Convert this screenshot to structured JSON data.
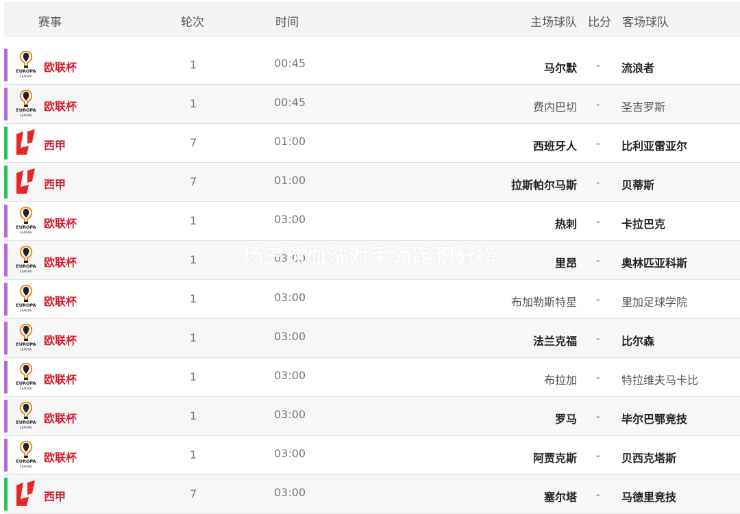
{
  "header": {
    "event": "赛事",
    "round": "轮次",
    "time": "时间",
    "home": "主场球队",
    "score": "比分",
    "away": "客场球队"
  },
  "colors": {
    "europa_bar": "#b36be0",
    "laliga_bar": "#27c25a",
    "league_text": "#d11f2e",
    "laliga_logo": "#e8262a"
  },
  "watermark": "场三球血洗对手领跑积分榜",
  "matches": [
    {
      "league": "欧联杯",
      "logo": "europa-league-logo",
      "round": "1",
      "time": "00:45",
      "home": "马尔默",
      "score": "-",
      "away": "流浪者",
      "home_bold": true,
      "away_bold": true
    },
    {
      "league": "欧联杯",
      "logo": "europa-league-logo",
      "round": "1",
      "time": "00:45",
      "home": "费内巴切",
      "score": "-",
      "away": "圣吉罗斯",
      "home_bold": false,
      "away_bold": false
    },
    {
      "league": "西甲",
      "logo": "laliga-logo",
      "round": "7",
      "time": "01:00",
      "home": "西班牙人",
      "score": "-",
      "away": "比利亚雷亚尔",
      "home_bold": true,
      "away_bold": true
    },
    {
      "league": "西甲",
      "logo": "laliga-logo",
      "round": "7",
      "time": "01:00",
      "home": "拉斯帕尔马斯",
      "score": "-",
      "away": "贝蒂斯",
      "home_bold": true,
      "away_bold": true
    },
    {
      "league": "欧联杯",
      "logo": "europa-league-logo",
      "round": "1",
      "time": "03:00",
      "home": "热刺",
      "score": "-",
      "away": "卡拉巴克",
      "home_bold": true,
      "away_bold": true
    },
    {
      "league": "欧联杯",
      "logo": "europa-league-logo",
      "round": "1",
      "time": "03:00",
      "home": "里昂",
      "score": "-",
      "away": "奥林匹亚科斯",
      "home_bold": true,
      "away_bold": true
    },
    {
      "league": "欧联杯",
      "logo": "europa-league-logo",
      "round": "1",
      "time": "03:00",
      "home": "布加勒斯特星",
      "score": "-",
      "away": "里加足球学院",
      "home_bold": false,
      "away_bold": false
    },
    {
      "league": "欧联杯",
      "logo": "europa-league-logo",
      "round": "1",
      "time": "03:00",
      "home": "法兰克福",
      "score": "-",
      "away": "比尔森",
      "home_bold": true,
      "away_bold": true
    },
    {
      "league": "欧联杯",
      "logo": "europa-league-logo",
      "round": "1",
      "time": "03:00",
      "home": "布拉加",
      "score": "-",
      "away": "特拉维夫马卡比",
      "home_bold": false,
      "away_bold": false
    },
    {
      "league": "欧联杯",
      "logo": "europa-league-logo",
      "round": "1",
      "time": "03:00",
      "home": "罗马",
      "score": "-",
      "away": "毕尔巴鄂竞技",
      "home_bold": true,
      "away_bold": true
    },
    {
      "league": "欧联杯",
      "logo": "europa-league-logo",
      "round": "1",
      "time": "03:00",
      "home": "阿贾克斯",
      "score": "-",
      "away": "贝西克塔斯",
      "home_bold": true,
      "away_bold": true
    },
    {
      "league": "西甲",
      "logo": "laliga-logo",
      "round": "7",
      "time": "03:00",
      "home": "塞尔塔",
      "score": "-",
      "away": "马德里竞技",
      "home_bold": true,
      "away_bold": true
    }
  ]
}
